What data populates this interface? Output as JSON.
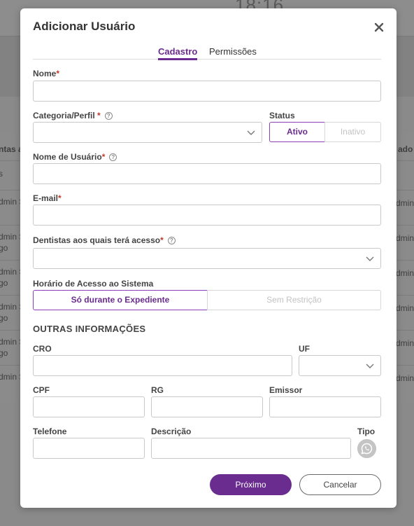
{
  "background": {
    "clock": "18:16",
    "header_left": "ntas a",
    "header_right": "ado",
    "rows_left": [
      "s",
      "dmin S",
      "dmin S",
      "go",
      "dmin S",
      "go",
      "dmin S",
      "go",
      "dmin S",
      "go",
      "dmin S"
    ],
    "rows_right": [
      "dmin",
      "dmin",
      "dmin",
      "dmin",
      "dmin",
      "dmin"
    ]
  },
  "modal": {
    "title": "Adicionar Usuário",
    "close_icon": "close-icon",
    "tabs": [
      {
        "label": "Cadastro",
        "active": true
      },
      {
        "label": "Permissões",
        "active": false
      }
    ],
    "fields": {
      "nome": {
        "label": "Nome",
        "required": "*",
        "value": ""
      },
      "categoria": {
        "label": "Categoria/Perfil",
        "required": "*",
        "value": ""
      },
      "status": {
        "label": "Status",
        "options": [
          "Ativo",
          "Inativo"
        ],
        "selected": "Ativo"
      },
      "usuario": {
        "label": "Nome de Usuário",
        "required": "*",
        "value": ""
      },
      "email": {
        "label": "E-mail",
        "required": "*",
        "value": ""
      },
      "dentistas": {
        "label": "Dentistas aos quais terá acesso",
        "required": "*",
        "value": ""
      },
      "horario": {
        "label": "Horário de Acesso ao Sistema",
        "options": [
          "Só durante o Expediente",
          "Sem Restrição"
        ],
        "selected": "Só durante o Expediente"
      }
    },
    "section_title": "OUTRAS INFORMAÇÕES",
    "other": {
      "cro": {
        "label": "CRO",
        "value": ""
      },
      "uf": {
        "label": "UF",
        "value": ""
      },
      "cpf": {
        "label": "CPF",
        "value": ""
      },
      "rg": {
        "label": "RG",
        "value": ""
      },
      "emissor": {
        "label": "Emissor",
        "value": ""
      },
      "telefone": {
        "label": "Telefone",
        "value": ""
      },
      "descricao": {
        "label": "Descrição",
        "value": ""
      },
      "tipo": {
        "label": "Tipo",
        "icon": "whatsapp-icon"
      }
    },
    "buttons": {
      "next": "Próximo",
      "cancel": "Cancelar"
    },
    "help_glyph": "?"
  },
  "colors": {
    "accent": "#6a2c8e",
    "required": "#c0392b",
    "overlay": "#8a8a8a"
  }
}
